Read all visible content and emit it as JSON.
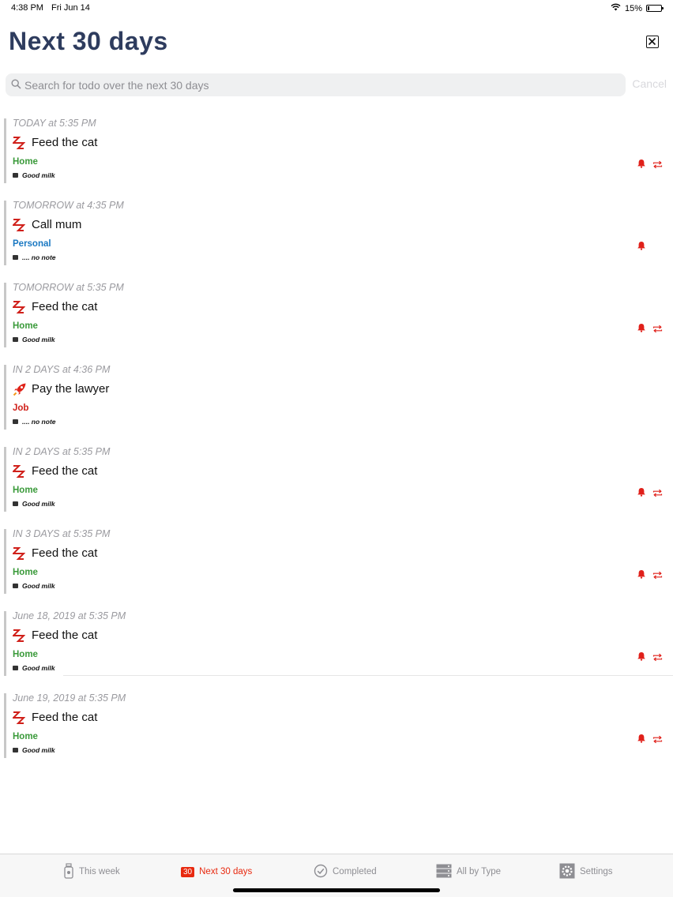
{
  "status_bar": {
    "time": "4:38 PM",
    "date": "Fri Jun 14",
    "battery": "15%",
    "battery_level": 0.15
  },
  "header": {
    "title": "Next 30 days"
  },
  "search": {
    "placeholder": "Search for todo over the next 30 days",
    "value": "",
    "cancel_label": "Cancel"
  },
  "todos": [
    {
      "when": "TODAY at 5:35 PM",
      "title": "Feed the cat",
      "icon": "zz-icon",
      "category": "Home",
      "category_color": "#3a9a3a",
      "note": "Good milk",
      "alarm": true,
      "repeat": true
    },
    {
      "when": "TOMORROW at 4:35 PM",
      "title": "Call mum",
      "icon": "zz-icon",
      "category": "Personal",
      "category_color": "#1a78c2",
      "note": ".... no note",
      "alarm": true,
      "repeat": false
    },
    {
      "when": "TOMORROW at 5:35 PM",
      "title": "Feed the cat",
      "icon": "zz-icon",
      "category": "Home",
      "category_color": "#3a9a3a",
      "note": "Good milk",
      "alarm": true,
      "repeat": true
    },
    {
      "when": "IN 2 DAYS at 4:36 PM",
      "title": "Pay the lawyer",
      "icon": "rocket-icon",
      "category": "Job",
      "category_color": "#d0201a",
      "note": ".... no note",
      "alarm": false,
      "repeat": false
    },
    {
      "when": "IN 2 DAYS at 5:35 PM",
      "title": "Feed the cat",
      "icon": "zz-icon",
      "category": "Home",
      "category_color": "#3a9a3a",
      "note": "Good milk",
      "alarm": true,
      "repeat": true
    },
    {
      "when": "IN 3 DAYS at 5:35 PM",
      "title": "Feed the cat",
      "icon": "zz-icon",
      "category": "Home",
      "category_color": "#3a9a3a",
      "note": "Good milk",
      "alarm": true,
      "repeat": true
    },
    {
      "when": "June 18, 2019 at 5:35 PM",
      "title": "Feed the cat",
      "icon": "zz-icon",
      "category": "Home",
      "category_color": "#3a9a3a",
      "note": "Good milk",
      "alarm": true,
      "repeat": true
    },
    {
      "when": "June 19, 2019 at 5:35 PM",
      "title": "Feed the cat",
      "icon": "zz-icon",
      "category": "Home",
      "category_color": "#3a9a3a",
      "note": "Good milk",
      "alarm": true,
      "repeat": true
    }
  ],
  "tabs": [
    {
      "label": "This week",
      "icon": "bottle-icon",
      "active": false
    },
    {
      "label": "Next 30 days",
      "badge": "30",
      "icon": "calendar-badge-icon",
      "active": true
    },
    {
      "label": "Completed",
      "icon": "check-circle-icon",
      "active": false
    },
    {
      "label": "All by Type",
      "icon": "server-icon",
      "active": false
    },
    {
      "label": "Settings",
      "icon": "gear-icon",
      "active": false
    }
  ],
  "colors": {
    "accent": "#e8290f",
    "title": "#2e3c5e",
    "bar": "#c8c8c8"
  }
}
